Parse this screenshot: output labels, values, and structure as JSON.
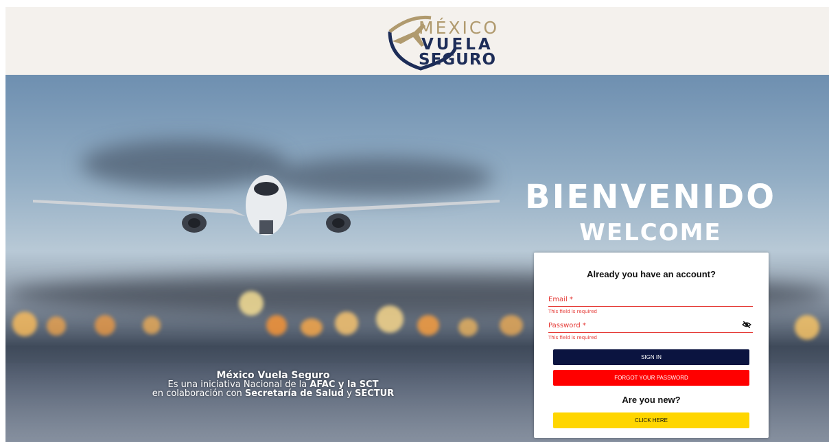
{
  "header": {
    "logo": {
      "line1": "MÉXICO",
      "line2": "VUELA",
      "line3": "SEGURO"
    }
  },
  "hero": {
    "title_es": "BIENVENIDO",
    "title_en": "WELCOME",
    "caption": {
      "line1": "México Vuela Seguro",
      "line2_prefix": "Es una iniciativa Nacional de la ",
      "line2_bold": "AFAC y la SCT",
      "line3_prefix": "en colaboración con ",
      "line3_bold1": "Secretaría de Salud",
      "line3_mid": " y ",
      "line3_bold2": "SECTUR"
    }
  },
  "login": {
    "heading": "Already you have an account?",
    "email_label": "Email *",
    "email_error": "This field is required",
    "password_label": "Password *",
    "password_error": "This field is required",
    "signin_label": "SIGN IN",
    "forgot_label": "FORGOT YOUR PASSWORD",
    "new_heading": "Are you new?",
    "click_label": "CLICK HERE"
  },
  "colors": {
    "signin": "#0b1440",
    "forgot": "#ff0000",
    "click": "#ffd600",
    "error": "#e53935"
  }
}
